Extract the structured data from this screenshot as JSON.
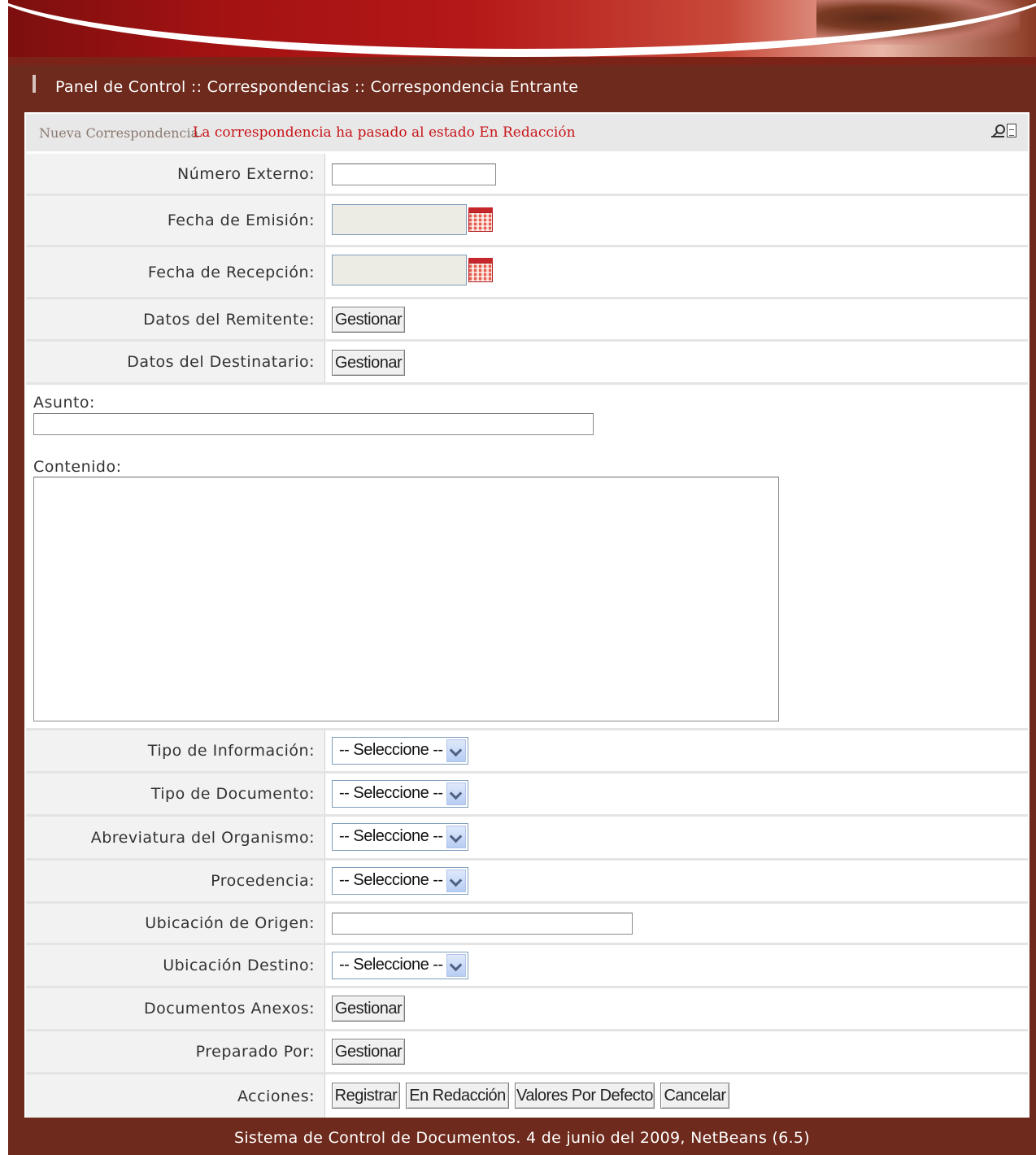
{
  "breadcrumb": "Panel de Control :: Correspondencias :: Correspondencia Entrante",
  "status": {
    "title": "Nueva Correspondencia",
    "message": "La correspondencia ha pasado al estado En Redacción",
    "icons": [
      "search-icon",
      "document-icon"
    ]
  },
  "fields": {
    "numero_externo": {
      "label": "Número Externo:",
      "value": ""
    },
    "fecha_emision": {
      "label": "Fecha de Emisión:",
      "value": ""
    },
    "fecha_recepcion": {
      "label": "Fecha de Recepción:",
      "value": ""
    },
    "remitente": {
      "label": "Datos del Remitente:",
      "button": "Gestionar"
    },
    "destinatario": {
      "label": "Datos del Destinatario:",
      "button": "Gestionar"
    },
    "asunto": {
      "label": "Asunto:",
      "value": ""
    },
    "contenido": {
      "label": "Contenido:",
      "value": ""
    },
    "tipo_informacion": {
      "label": "Tipo de Información:",
      "selected": "-- Seleccione --"
    },
    "tipo_documento": {
      "label": "Tipo de Documento:",
      "selected": "-- Seleccione --"
    },
    "abreviatura": {
      "label": "Abreviatura del Organismo:",
      "selected": "-- Seleccione --"
    },
    "procedencia": {
      "label": "Procedencia:",
      "selected": "-- Seleccione --"
    },
    "ubicacion_origen": {
      "label": "Ubicación de Origen:",
      "value": ""
    },
    "ubicacion_destino": {
      "label": "Ubicación Destino:",
      "selected": "-- Seleccione --"
    },
    "documentos_anexos": {
      "label": "Documentos Anexos:",
      "button": "Gestionar"
    },
    "preparado_por": {
      "label": "Preparado Por:",
      "button": "Gestionar"
    }
  },
  "actions": {
    "label": "Acciones:",
    "registrar": "Registrar",
    "en_redaccion": "En Redacción",
    "valores_defecto": "Valores Por Defecto",
    "cancelar": "Cancelar"
  },
  "footer": "Sistema de Control de Documentos. 4 de junio del 2009, NetBeans (6.5)",
  "colors": {
    "frame": "#6e2a1c",
    "status_message": "#c8141a",
    "label_bg": "#f2f2f2"
  }
}
